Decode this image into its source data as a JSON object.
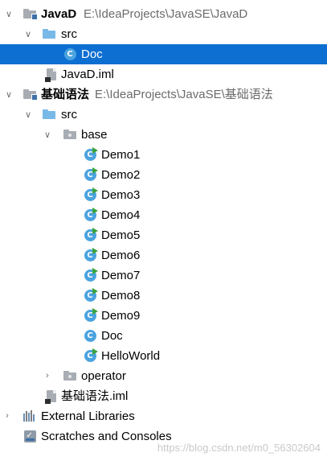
{
  "tree": {
    "javad": {
      "name": "JavaD",
      "path": "E:\\IdeaProjects\\JavaSE\\JavaD"
    },
    "javad_src": {
      "name": "src"
    },
    "javad_doc": {
      "name": "Doc"
    },
    "javad_iml": {
      "name": "JavaD.iml"
    },
    "jichu": {
      "name": "基础语法",
      "path": "E:\\IdeaProjects\\JavaSE\\基础语法"
    },
    "jichu_src": {
      "name": "src"
    },
    "base": {
      "name": "base"
    },
    "classes": [
      "Demo1",
      "Demo2",
      "Demo3",
      "Demo4",
      "Demo5",
      "Demo6",
      "Demo7",
      "Demo8",
      "Demo9",
      "Doc",
      "HelloWorld"
    ],
    "operator": {
      "name": "operator"
    },
    "jichu_iml": {
      "name": "基础语法.iml"
    },
    "external_libraries": {
      "name": "External Libraries"
    },
    "scratches": {
      "name": "Scratches and Consoles"
    }
  },
  "watermark": "https://blog.csdn.net/m0_56302604",
  "colors": {
    "selection": "#0d6fd1",
    "class_icon": "#4aa3df",
    "folder_blue": "#79b9e8",
    "path_gray": "#6b6b6b"
  }
}
